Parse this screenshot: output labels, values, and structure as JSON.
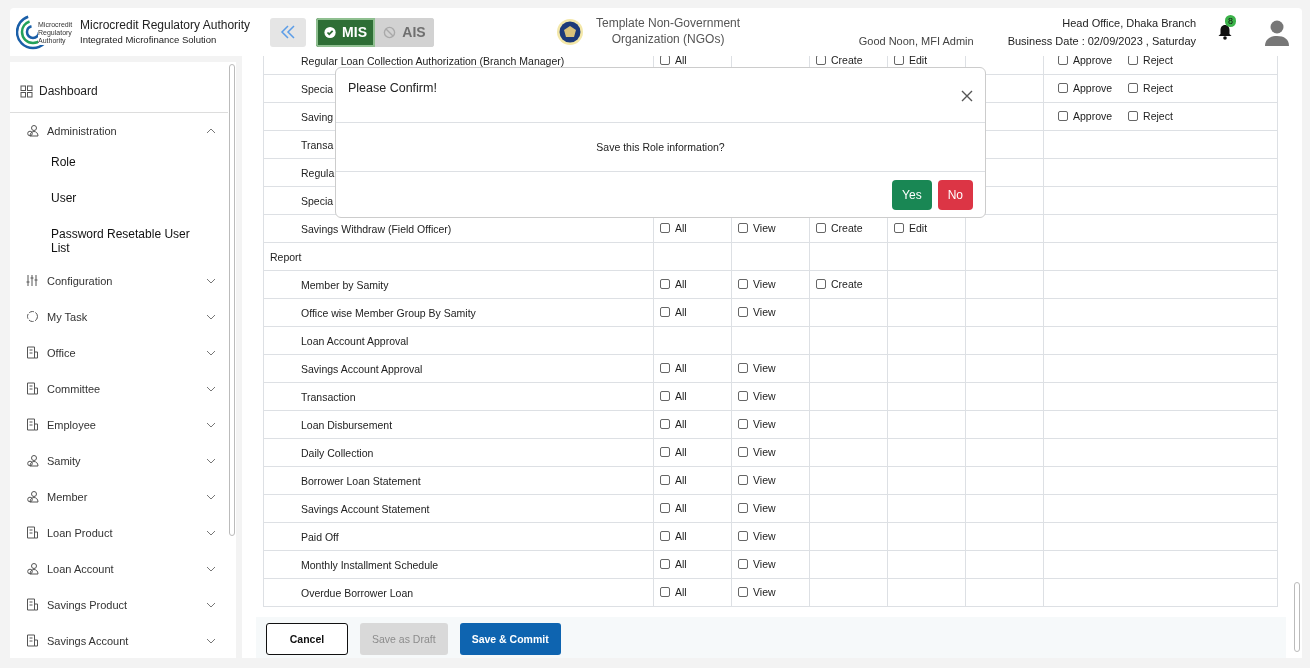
{
  "header": {
    "logo_text": [
      "Microcredit",
      "Regulatory",
      "Authority"
    ],
    "title": "Microcredit Regulatory Authority",
    "subtitle": "Integrated Microfinance Solution",
    "modules": [
      {
        "label": "MIS",
        "selected": true
      },
      {
        "label": "AIS",
        "selected": false
      }
    ],
    "org_name": [
      "Template Non-Government",
      "Organization (NGOs)"
    ],
    "greeting": "Good Noon, MFI Admin",
    "branch": "Head Office, Dhaka Branch",
    "business_date": "Business Date : 02/09/2023 , Saturday",
    "notifications": "8"
  },
  "sidebar": {
    "items": [
      {
        "label": "Dashboard",
        "kind": "link"
      },
      {
        "label": "Administration",
        "kind": "group",
        "expanded": true,
        "children": [
          {
            "label": "Role"
          },
          {
            "label": "User"
          },
          {
            "label": "Password Resetable User List"
          }
        ]
      },
      {
        "label": "Configuration",
        "kind": "group",
        "expanded": false
      },
      {
        "label": "My Task",
        "kind": "group",
        "expanded": false
      },
      {
        "label": "Office",
        "kind": "group",
        "expanded": false
      },
      {
        "label": "Committee",
        "kind": "group",
        "expanded": false
      },
      {
        "label": "Employee",
        "kind": "group",
        "expanded": false
      },
      {
        "label": "Samity",
        "kind": "group",
        "expanded": false
      },
      {
        "label": "Member",
        "kind": "group",
        "expanded": false
      },
      {
        "label": "Loan Product",
        "kind": "group",
        "expanded": false
      },
      {
        "label": "Loan Account",
        "kind": "group",
        "expanded": false
      },
      {
        "label": "Savings Product",
        "kind": "group",
        "expanded": false
      },
      {
        "label": "Savings Account",
        "kind": "group",
        "expanded": false
      }
    ]
  },
  "permissions": {
    "rows": [
      {
        "kind": "item",
        "name": "Regular Loan Collection Authorization (Branch Manager)",
        "all": {
          "label": "All",
          "checked": false
        },
        "create": {
          "label": "Create",
          "checked": false
        },
        "edit": {
          "label": "Edit",
          "checked": false
        },
        "approve": {
          "label": "Approve",
          "checked": false
        },
        "reject": {
          "label": "Reject",
          "checked": false
        }
      },
      {
        "kind": "item",
        "name": "Specia",
        "approve": {
          "label": "Approve",
          "checked": false
        },
        "reject": {
          "label": "Reject",
          "checked": false
        }
      },
      {
        "kind": "item",
        "name": "Saving",
        "approve": {
          "label": "Approve",
          "checked": false
        },
        "reject": {
          "label": "Reject",
          "checked": false
        }
      },
      {
        "kind": "item",
        "name": "Transa"
      },
      {
        "kind": "item",
        "name": "Regula"
      },
      {
        "kind": "item",
        "name": "Specia"
      },
      {
        "kind": "item",
        "name": "Savings Withdraw (Field Officer)",
        "all": {
          "label": "All",
          "checked": false
        },
        "view": {
          "label": "View",
          "checked": false
        },
        "create": {
          "label": "Create",
          "checked": false
        },
        "edit": {
          "label": "Edit",
          "checked": false
        }
      },
      {
        "kind": "group",
        "name": "Report"
      },
      {
        "kind": "item",
        "name": "Member by Samity",
        "all": {
          "label": "All",
          "checked": false
        },
        "view": {
          "label": "View",
          "checked": false
        },
        "create": {
          "label": "Create",
          "checked": false
        }
      },
      {
        "kind": "item",
        "name": "Office wise Member Group By Samity",
        "all": {
          "label": "All",
          "checked": false
        },
        "view": {
          "label": "View",
          "checked": false
        }
      },
      {
        "kind": "item",
        "name": "Loan Account Approval"
      },
      {
        "kind": "item",
        "name": "Savings Account Approval",
        "all": {
          "label": "All",
          "checked": false
        },
        "view": {
          "label": "View",
          "checked": false
        }
      },
      {
        "kind": "item",
        "name": "Transaction",
        "all": {
          "label": "All",
          "checked": false
        },
        "view": {
          "label": "View",
          "checked": false
        }
      },
      {
        "kind": "item",
        "name": "Loan Disbursement",
        "all": {
          "label": "All",
          "checked": false
        },
        "view": {
          "label": "View",
          "checked": false
        }
      },
      {
        "kind": "item",
        "name": "Daily Collection",
        "all": {
          "label": "All",
          "checked": false
        },
        "view": {
          "label": "View",
          "checked": false
        }
      },
      {
        "kind": "item",
        "name": "Borrower Loan Statement",
        "all": {
          "label": "All",
          "checked": false
        },
        "view": {
          "label": "View",
          "checked": false
        }
      },
      {
        "kind": "item",
        "name": "Savings Account Statement",
        "all": {
          "label": "All",
          "checked": false
        },
        "view": {
          "label": "View",
          "checked": false
        }
      },
      {
        "kind": "item",
        "name": "Paid Off",
        "all": {
          "label": "All",
          "checked": false
        },
        "view": {
          "label": "View",
          "checked": false
        }
      },
      {
        "kind": "item",
        "name": "Monthly Installment Schedule",
        "all": {
          "label": "All",
          "checked": false
        },
        "view": {
          "label": "View",
          "checked": false
        }
      },
      {
        "kind": "item",
        "name": "Overdue Borrower Loan",
        "all": {
          "label": "All",
          "checked": false
        },
        "view": {
          "label": "View",
          "checked": false
        }
      }
    ]
  },
  "footer": {
    "buttons": [
      {
        "label": "Cancel",
        "kind": "outline",
        "disabled": false
      },
      {
        "label": "Save as Draft",
        "kind": "secondary",
        "disabled": true
      },
      {
        "label": "Save & Commit",
        "kind": "primary",
        "disabled": false
      }
    ]
  },
  "dialog": {
    "title": "Please Confirm!",
    "message": "Save this Role information?",
    "buttons": [
      {
        "label": "Yes",
        "kind": "success"
      },
      {
        "label": "No",
        "kind": "danger"
      }
    ]
  }
}
